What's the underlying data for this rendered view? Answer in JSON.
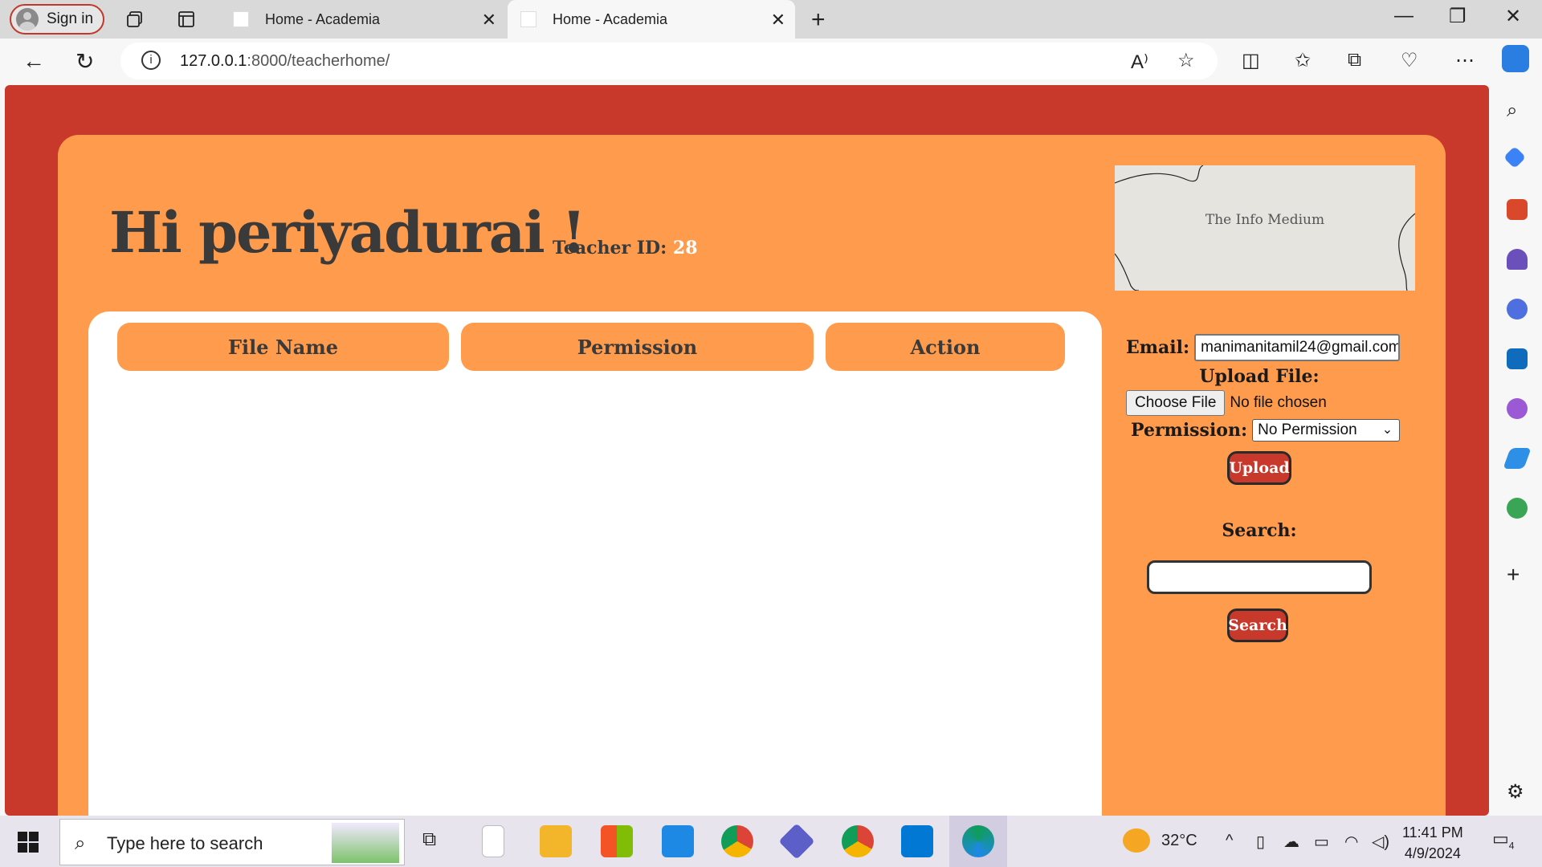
{
  "browser": {
    "signin_label": "Sign in",
    "tabs": [
      {
        "title": "Home - Academia"
      },
      {
        "title": "Home - Academia"
      }
    ],
    "url_host": "127.0.0.1",
    "url_path": ":8000/teacherhome/"
  },
  "page": {
    "greeting": "Hi periyadurai !",
    "teacher_id_label": "Teacher ID:",
    "teacher_id_value": "28",
    "logo_text": "The Info Medium",
    "table_headers": [
      "File Name",
      "Permission",
      "Action"
    ],
    "form": {
      "email_label": "Email:",
      "email_value": "manimanitamil24@gmail.com",
      "upload_file_label": "Upload File:",
      "choose_file_label": "Choose File",
      "file_status": "No file chosen",
      "permission_label": "Permission:",
      "permission_selected": "No Permission",
      "upload_button": "Upload",
      "search_label": "Search:",
      "search_value": "",
      "search_button": "Search"
    }
  },
  "taskbar": {
    "search_placeholder": "Type here to search",
    "weather": "32°C",
    "time": "11:41 PM",
    "date": "4/9/2024",
    "notification_count": "4"
  },
  "colors": {
    "page_red": "#c9392b",
    "page_orange": "#ff9b4d"
  }
}
